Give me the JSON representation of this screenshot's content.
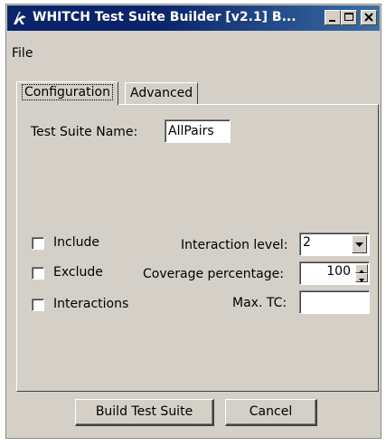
{
  "window": {
    "title": "WHITCH Test Suite Builder [v2.1] B...",
    "app_icon": "swing-cup-icon",
    "controls": [
      "minimize-icon",
      "maximize-icon",
      "close-icon"
    ],
    "title_color": "#0a246a"
  },
  "menubar": {
    "items": [
      {
        "label": "File"
      }
    ]
  },
  "tabs": [
    {
      "label": "Configuration",
      "active": true
    },
    {
      "label": "Advanced",
      "active": false
    }
  ],
  "config": {
    "suite_name_label": "Test Suite Name:",
    "suite_name_value": "AllPairs",
    "include_label": "Include",
    "exclude_label": "Exclude",
    "interactions_label": "Interactions",
    "interaction_level_label": "Interaction level:",
    "interaction_level_value": "2",
    "coverage_label": "Coverage percentage:",
    "coverage_value": "100",
    "max_tc_label": "Max. TC:",
    "max_tc_value": ""
  },
  "buttons": {
    "build": "Build Test Suite",
    "cancel": "Cancel"
  }
}
